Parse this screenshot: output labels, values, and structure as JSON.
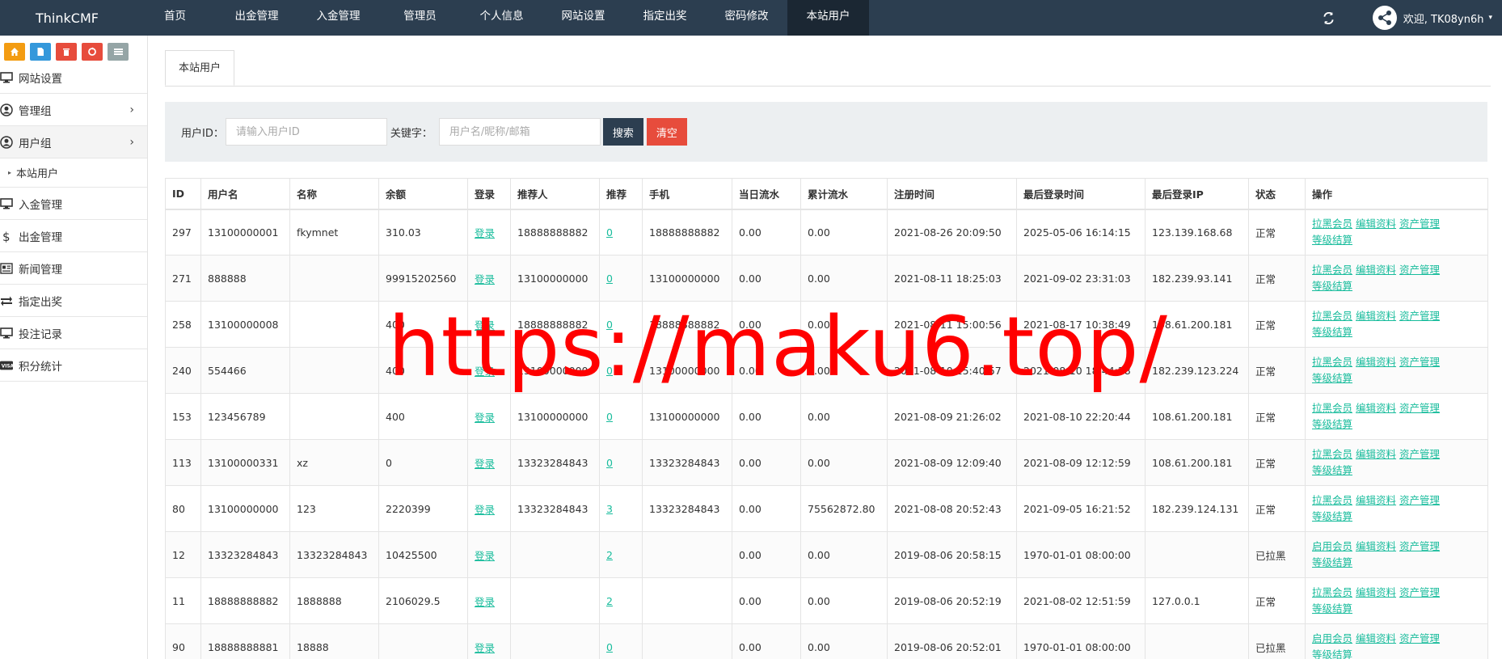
{
  "brand": "ThinkCMF",
  "topnav": [
    "首页",
    "出金管理",
    "入金管理",
    "管理员",
    "个人信息",
    "网站设置",
    "指定出奖",
    "密码修改",
    "本站用户"
  ],
  "topnav_active": 8,
  "user": {
    "welcome": "欢迎, TK08yn6h",
    "caret": "▾"
  },
  "sidebar": {
    "shortcuts": [
      {
        "icon": "home-icon",
        "color": "#f39c12"
      },
      {
        "icon": "file-icon",
        "color": "#3498db"
      },
      {
        "icon": "trash-icon",
        "color": "#e74c3c"
      },
      {
        "icon": "recycle-icon",
        "color": "#e74c3c"
      },
      {
        "icon": "list-icon",
        "color": "#95a5a6"
      }
    ],
    "items": [
      {
        "label": "网站设置",
        "icon": "monitor-icon"
      },
      {
        "label": "管理组",
        "icon": "user-circle-icon",
        "chevron": "›"
      },
      {
        "label": "用户组",
        "icon": "user-circle-icon",
        "chevron": "›"
      },
      {
        "label": "入金管理",
        "icon": "monitor-icon"
      },
      {
        "label": "出金管理",
        "icon": "dollar-icon"
      },
      {
        "label": "新闻管理",
        "icon": "newspaper-icon"
      },
      {
        "label": "指定出奖",
        "icon": "exchange-icon"
      },
      {
        "label": "投注记录",
        "icon": "monitor-icon"
      },
      {
        "label": "积分统计",
        "icon": "visa-icon"
      }
    ],
    "submenu_item": "本站用户"
  },
  "tab": "本站用户",
  "filter": {
    "uid_label": "用户ID：",
    "uid_placeholder": "请输入用户ID",
    "kw_label": "关键字：",
    "kw_placeholder": "用户名/昵称/邮箱",
    "search_btn": "搜索",
    "clear_btn": "清空"
  },
  "table": {
    "headers": [
      "ID",
      "用户名",
      "名称",
      "余额",
      "登录",
      "推荐人",
      "推荐",
      "手机",
      "当日流水",
      "累计流水",
      "注册时间",
      "最后登录时间",
      "最后登录IP",
      "状态",
      "操作"
    ],
    "rows": [
      {
        "id": "297",
        "username": "13100000001",
        "name": "fkymnet",
        "balance": "310.03",
        "login": "登录",
        "referrer": "18888888882",
        "rec": "0",
        "phone": "18888888882",
        "daily": "0.00",
        "total": "0.00",
        "reg": "2021-08-26 20:09:50",
        "last": "2025-05-06 16:14:15",
        "ip": "123.139.168.68",
        "status": "正常",
        "ops": [
          "拉黑会员",
          "编辑资料",
          "资产管理",
          "等级结算"
        ]
      },
      {
        "id": "271",
        "username": "888888",
        "name": "",
        "balance": "99915202560",
        "login": "登录",
        "referrer": "13100000000",
        "rec": "0",
        "phone": "13100000000",
        "daily": "0.00",
        "total": "0.00",
        "reg": "2021-08-11 18:25:03",
        "last": "2021-09-02 23:31:03",
        "ip": "182.239.93.141",
        "status": "正常",
        "ops": [
          "拉黑会员",
          "编辑资料",
          "资产管理",
          "等级结算"
        ]
      },
      {
        "id": "258",
        "username": "13100000008",
        "name": "",
        "balance": "400",
        "login": "登录",
        "referrer": "18888888882",
        "rec": "0",
        "phone": "18888888882",
        "daily": "0.00",
        "total": "0.00",
        "reg": "2021-08-11 15:00:56",
        "last": "2021-08-17 10:38:49",
        "ip": "108.61.200.181",
        "status": "正常",
        "ops": [
          "拉黑会员",
          "编辑资料",
          "资产管理",
          "等级结算"
        ]
      },
      {
        "id": "240",
        "username": "554466",
        "name": "",
        "balance": "400",
        "login": "登录",
        "referrer": "13100000000",
        "rec": "0",
        "phone": "13100000000",
        "daily": "0.00",
        "total": "0.00",
        "reg": "2021-08-10 15:40:57",
        "last": "2021-08-10 18:44:28",
        "ip": "182.239.123.224",
        "status": "正常",
        "ops": [
          "拉黑会员",
          "编辑资料",
          "资产管理",
          "等级结算"
        ]
      },
      {
        "id": "153",
        "username": "123456789",
        "name": "",
        "balance": "400",
        "login": "登录",
        "referrer": "13100000000",
        "rec": "0",
        "phone": "13100000000",
        "daily": "0.00",
        "total": "0.00",
        "reg": "2021-08-09 21:26:02",
        "last": "2021-08-10 22:20:44",
        "ip": "108.61.200.181",
        "status": "正常",
        "ops": [
          "拉黑会员",
          "编辑资料",
          "资产管理",
          "等级结算"
        ]
      },
      {
        "id": "113",
        "username": "13100000331",
        "name": "xz",
        "balance": "0",
        "login": "登录",
        "referrer": "13323284843",
        "rec": "0",
        "phone": "13323284843",
        "daily": "0.00",
        "total": "0.00",
        "reg": "2021-08-09 12:09:40",
        "last": "2021-08-09 12:12:59",
        "ip": "108.61.200.181",
        "status": "正常",
        "ops": [
          "拉黑会员",
          "编辑资料",
          "资产管理",
          "等级结算"
        ]
      },
      {
        "id": "80",
        "username": "13100000000",
        "name": "123",
        "balance": "2220399",
        "login": "登录",
        "referrer": "13323284843",
        "rec": "3",
        "phone": "13323284843",
        "daily": "0.00",
        "total": "75562872.80",
        "reg": "2021-08-08 20:52:43",
        "last": "2021-09-05 16:21:52",
        "ip": "182.239.124.131",
        "status": "正常",
        "ops": [
          "拉黑会员",
          "编辑资料",
          "资产管理",
          "等级结算"
        ]
      },
      {
        "id": "12",
        "username": "13323284843",
        "name": "13323284843",
        "balance": "10425500",
        "login": "登录",
        "referrer": "",
        "rec": "2",
        "phone": "",
        "daily": "0.00",
        "total": "0.00",
        "reg": "2019-08-06 20:58:15",
        "last": "1970-01-01 08:00:00",
        "ip": "",
        "status": "已拉黑",
        "ops": [
          "启用会员",
          "编辑资料",
          "资产管理",
          "等级结算"
        ]
      },
      {
        "id": "11",
        "username": "18888888882",
        "name": "1888888",
        "balance": "2106029.5",
        "login": "登录",
        "referrer": "",
        "rec": "2",
        "phone": "",
        "daily": "0.00",
        "total": "0.00",
        "reg": "2019-08-06 20:52:19",
        "last": "2021-08-02 12:51:59",
        "ip": "127.0.0.1",
        "status": "正常",
        "ops": [
          "拉黑会员",
          "编辑资料",
          "资产管理",
          "等级结算"
        ]
      },
      {
        "id": "90",
        "username": "18888888881",
        "name": "18888",
        "balance": "",
        "login": "登录",
        "referrer": "",
        "rec": "0",
        "phone": "",
        "daily": "0.00",
        "total": "0.00",
        "reg": "2019-08-06 20:52:01",
        "last": "1970-01-01 08:00:00",
        "ip": "",
        "status": "已拉黑",
        "ops": [
          "启用会员",
          "编辑资料",
          "资产管理",
          "等级结算"
        ]
      }
    ]
  },
  "watermark": "https://maku6.top/"
}
